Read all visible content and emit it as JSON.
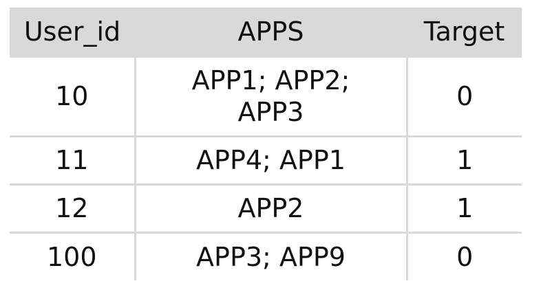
{
  "table": {
    "headers": [
      "User_id",
      "APPS",
      "Target"
    ],
    "rows": [
      {
        "user_id": "10",
        "apps": "APP1; APP2; APP3",
        "target": "0"
      },
      {
        "user_id": "11",
        "apps": "APP4; APP1",
        "target": "1"
      },
      {
        "user_id": "12",
        "apps": "APP2",
        "target": "1"
      },
      {
        "user_id": "100",
        "apps": "APP3; APP9",
        "target": "0"
      }
    ]
  },
  "colors": {
    "header_bg": "#d9d9d9",
    "grid_line": "#d9d9d9",
    "text": "#111111"
  }
}
